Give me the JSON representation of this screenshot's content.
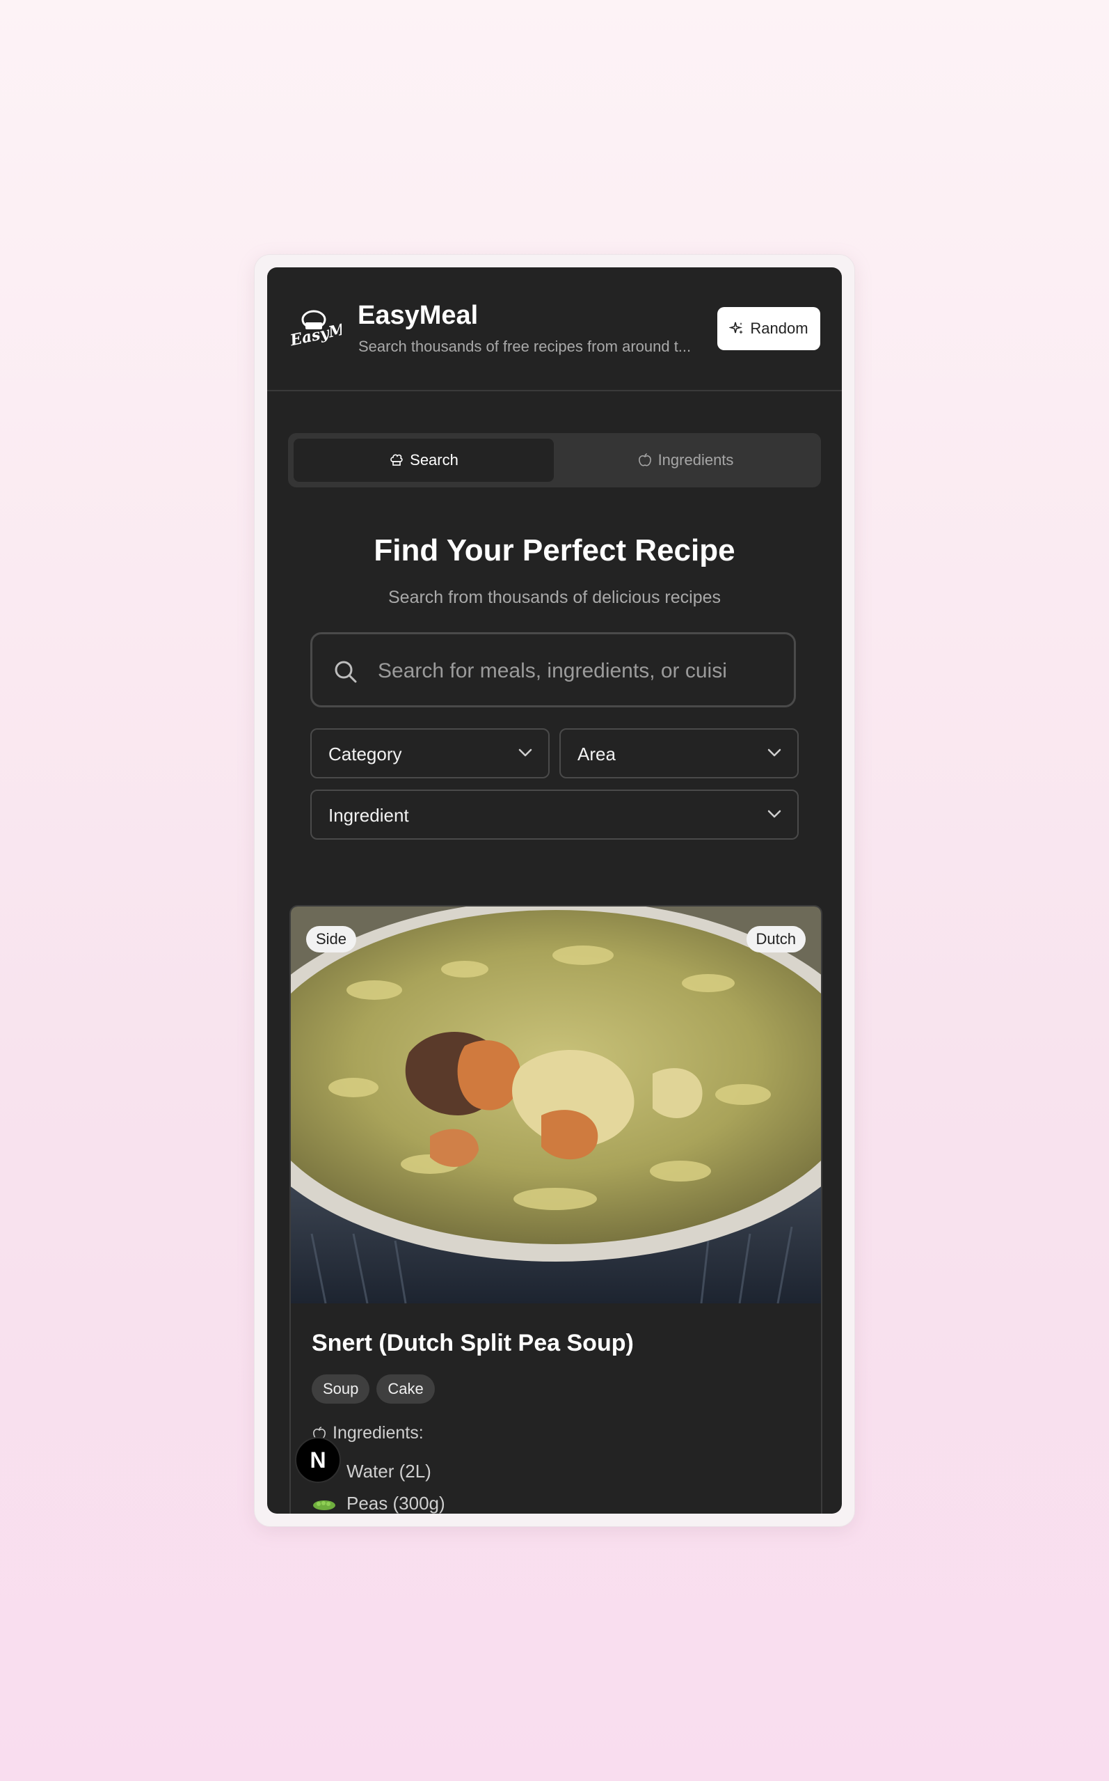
{
  "header": {
    "logo_icon": "easymeal-logo",
    "title": "EasyMeal",
    "subtitle": "Search thousands of free recipes from around t...",
    "random_button": {
      "icon": "sparkles-icon",
      "label": "Random"
    }
  },
  "tabs": [
    {
      "icon": "chef-hat-icon",
      "label": "Search",
      "active": true
    },
    {
      "icon": "apple-icon",
      "label": "Ingredients",
      "active": false
    }
  ],
  "hero": {
    "title": "Find Your Perfect Recipe",
    "subtitle": "Search from thousands of delicious recipes"
  },
  "search": {
    "placeholder": "Search for meals, ingredients, or cuisi",
    "value": ""
  },
  "filters": {
    "category": "Category",
    "area": "Area",
    "ingredient": "Ingredient"
  },
  "meal_card": {
    "category_badge": "Side",
    "area_badge": "Dutch",
    "title": "Snert (Dutch Split Pea Soup)",
    "tags": [
      "Soup",
      "Cake"
    ],
    "ingredients_heading": "Ingredients:",
    "ingredients": [
      {
        "name": "Water (2L)"
      },
      {
        "name": "Peas (300g)"
      }
    ]
  },
  "dev_badge": {
    "letter": "N"
  },
  "colors": {
    "page_background": "#fdf3f6",
    "app_background": "#232323",
    "accent_text": "#ffffff",
    "muted_text": "#a9a9a9"
  }
}
